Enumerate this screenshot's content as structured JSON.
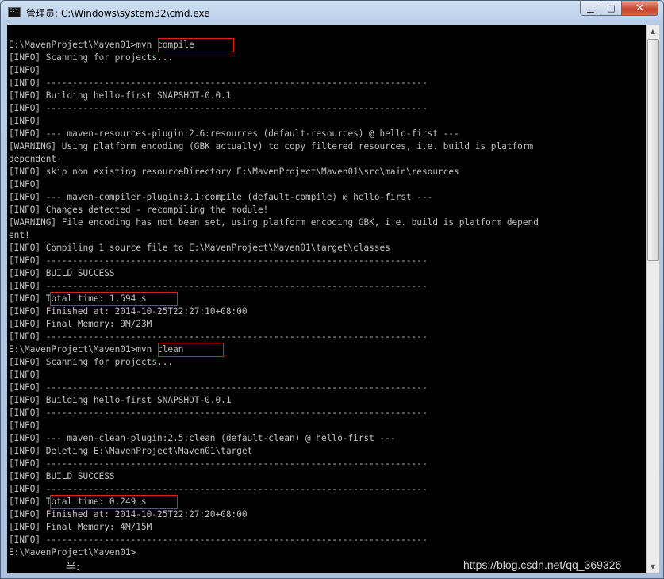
{
  "window": {
    "title": "管理员: C:\\Windows\\system32\\cmd.exe",
    "icon": "cmd-icon",
    "buttons": {
      "minimize": "▁",
      "maximize": "□",
      "close": "✕"
    }
  },
  "console": {
    "lines": [
      "E:\\MavenProject\\Maven01>mvn compile",
      "[INFO] Scanning for projects...",
      "[INFO]",
      "[INFO] ------------------------------------------------------------------------",
      "[INFO] Building hello-first SNAPSHOT-0.0.1",
      "[INFO] ------------------------------------------------------------------------",
      "[INFO]",
      "[INFO] --- maven-resources-plugin:2.6:resources (default-resources) @ hello-first ---",
      "[WARNING] Using platform encoding (GBK actually) to copy filtered resources, i.e. build is platform",
      "dependent!",
      "[INFO] skip non existing resourceDirectory E:\\MavenProject\\Maven01\\src\\main\\resources",
      "[INFO]",
      "[INFO] --- maven-compiler-plugin:3.1:compile (default-compile) @ hello-first ---",
      "[INFO] Changes detected - recompiling the module!",
      "[WARNING] File encoding has not been set, using platform encoding GBK, i.e. build is platform depend",
      "ent!",
      "[INFO] Compiling 1 source file to E:\\MavenProject\\Maven01\\target\\classes",
      "[INFO] ------------------------------------------------------------------------",
      "[INFO] BUILD SUCCESS",
      "[INFO] ------------------------------------------------------------------------",
      "[INFO] Total time: 1.594 s",
      "[INFO] Finished at: 2014-10-25T22:27:10+08:00",
      "[INFO] Final Memory: 9M/23M",
      "[INFO] ------------------------------------------------------------------------",
      "E:\\MavenProject\\Maven01>mvn clean",
      "[INFO] Scanning for projects...",
      "[INFO]",
      "[INFO] ------------------------------------------------------------------------",
      "[INFO] Building hello-first SNAPSHOT-0.0.1",
      "[INFO] ------------------------------------------------------------------------",
      "[INFO]",
      "[INFO] --- maven-clean-plugin:2.5:clean (default-clean) @ hello-first ---",
      "[INFO] Deleting E:\\MavenProject\\Maven01\\target",
      "[INFO] ------------------------------------------------------------------------",
      "[INFO] BUILD SUCCESS",
      "[INFO] ------------------------------------------------------------------------",
      "[INFO] Total time: 0.249 s",
      "[INFO] Finished at: 2014-10-25T22:27:20+08:00",
      "[INFO] Final Memory: 4M/15M",
      "[INFO] ------------------------------------------------------------------------",
      "E:\\MavenProject\\Maven01>"
    ],
    "ime_status": "半:",
    "colors": {
      "background": "#000000",
      "text": "#c0c0c0",
      "highlight_box": "#e02020"
    }
  },
  "watermark": "https://blog.csdn.net/qq_369326"
}
